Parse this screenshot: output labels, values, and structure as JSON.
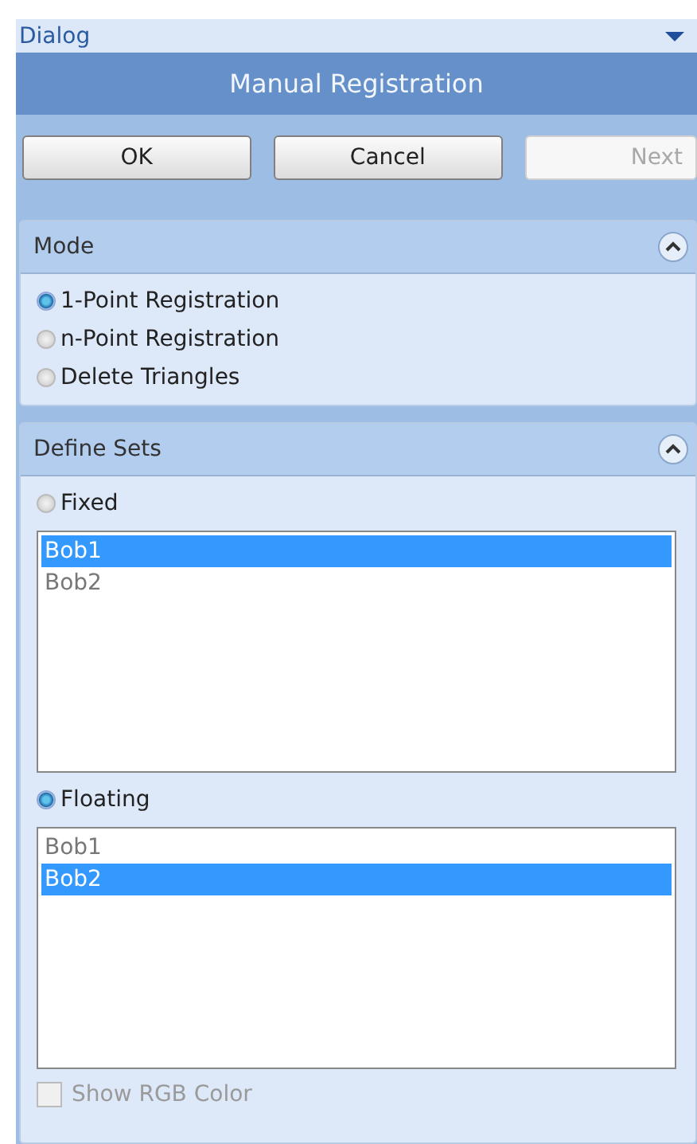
{
  "window": {
    "title": "Dialog"
  },
  "header": "Manual Registration",
  "buttons": [
    {
      "label": "OK",
      "disabled": false
    },
    {
      "label": "Cancel",
      "disabled": false
    },
    {
      "label": "Next",
      "disabled": true
    }
  ],
  "mode": {
    "title": "Mode",
    "expanded": true,
    "options": [
      {
        "label": "1-Point Registration",
        "selected": true
      },
      {
        "label": "n-Point Registration",
        "selected": false
      },
      {
        "label": "Delete Triangles",
        "selected": false
      }
    ]
  },
  "define_sets": {
    "title": "Define Sets",
    "expanded": true,
    "sets": [
      {
        "label": "Fixed",
        "selected": false,
        "items": [
          {
            "label": "Bob1",
            "selected": true
          },
          {
            "label": "Bob2",
            "selected": false
          }
        ]
      },
      {
        "label": "Floating",
        "selected": true,
        "items": [
          {
            "label": "Bob1",
            "selected": false
          },
          {
            "label": "Bob2",
            "selected": true
          }
        ]
      }
    ],
    "show_rgb": {
      "label": "Show RGB Color",
      "checked": false,
      "disabled": true
    }
  }
}
